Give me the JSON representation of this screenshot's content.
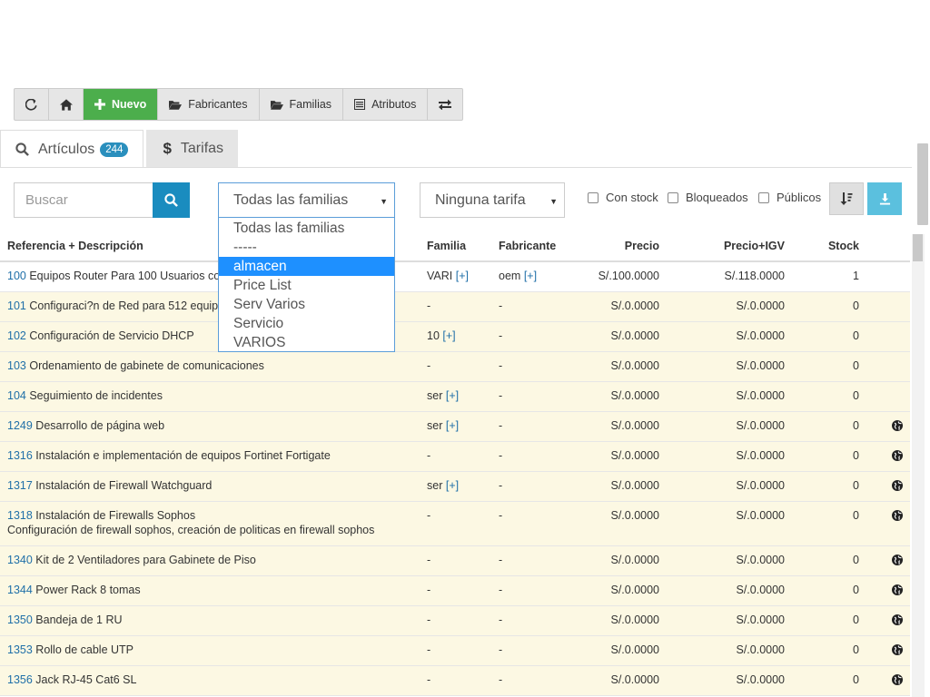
{
  "toolbar": {
    "nuevo_label": "Nuevo",
    "fabricantes_label": "Fabricantes",
    "familias_label": "Familias",
    "atributos_label": "Atributos"
  },
  "tabs": {
    "articulos_label": "Artículos",
    "articulos_count": "244",
    "tarifas_label": "Tarifas"
  },
  "filters": {
    "search_placeholder": "Buscar",
    "familia_selected": "Todas las familias",
    "tarifa_selected": "Ninguna tarifa",
    "con_stock": "Con stock",
    "bloqueados": "Bloqueados",
    "publicos": "Públicos"
  },
  "family_dropdown": {
    "options": [
      "Todas las familias",
      "-----",
      "almacen",
      "Price List",
      "Serv Varios",
      "Servicio",
      "VARIOS"
    ],
    "highlighted": "almacen"
  },
  "table": {
    "headers": {
      "ref_desc": "Referencia + Descripción",
      "familia": "Familia",
      "fabricante": "Fabricante",
      "precio": "Precio",
      "precio_igv": "Precio+IGV",
      "stock": "Stock"
    },
    "rows": [
      {
        "ref": "100",
        "desc": "Equipos Router Para 100 Usuarios co",
        "desc2": "",
        "fam": "VARI",
        "fam_plus": "[+]",
        "fab": "oem",
        "fab_plus": "[+]",
        "precio": "S/.100.0000",
        "igv": "S/.118.0000",
        "stock": "1",
        "public": false
      },
      {
        "ref": "101",
        "desc": "Configuraci?n de Red para 512 equipo",
        "desc2": "",
        "fam": "-",
        "fam_plus": "",
        "fab": "-",
        "fab_plus": "",
        "precio": "S/.0.0000",
        "igv": "S/.0.0000",
        "stock": "0",
        "public": false
      },
      {
        "ref": "102",
        "desc": "Configuración de Servicio DHCP",
        "desc2": "",
        "fam": "10",
        "fam_plus": "[+]",
        "fab": "-",
        "fab_plus": "",
        "precio": "S/.0.0000",
        "igv": "S/.0.0000",
        "stock": "0",
        "public": false
      },
      {
        "ref": "103",
        "desc": "Ordenamiento de gabinete de comunicaciones",
        "desc2": "",
        "fam": "-",
        "fam_plus": "",
        "fab": "-",
        "fab_plus": "",
        "precio": "S/.0.0000",
        "igv": "S/.0.0000",
        "stock": "0",
        "public": false
      },
      {
        "ref": "104",
        "desc": "Seguimiento de incidentes",
        "desc2": "",
        "fam": "ser",
        "fam_plus": "[+]",
        "fab": "-",
        "fab_plus": "",
        "precio": "S/.0.0000",
        "igv": "S/.0.0000",
        "stock": "0",
        "public": false
      },
      {
        "ref": "1249",
        "desc": "Desarrollo de página web",
        "desc2": "",
        "fam": "ser",
        "fam_plus": "[+]",
        "fab": "-",
        "fab_plus": "",
        "precio": "S/.0.0000",
        "igv": "S/.0.0000",
        "stock": "0",
        "public": true
      },
      {
        "ref": "1316",
        "desc": "Instalación e implementación de equipos Fortinet Fortigate",
        "desc2": "",
        "fam": "-",
        "fam_plus": "",
        "fab": "-",
        "fab_plus": "",
        "precio": "S/.0.0000",
        "igv": "S/.0.0000",
        "stock": "0",
        "public": true
      },
      {
        "ref": "1317",
        "desc": "Instalación de Firewall Watchguard",
        "desc2": "",
        "fam": "ser",
        "fam_plus": "[+]",
        "fab": "-",
        "fab_plus": "",
        "precio": "S/.0.0000",
        "igv": "S/.0.0000",
        "stock": "0",
        "public": true
      },
      {
        "ref": "1318",
        "desc": "Instalación de Firewalls Sophos",
        "desc2": "Configuración de firewall sophos, creación de politicas en firewall sophos",
        "fam": "-",
        "fam_plus": "",
        "fab": "-",
        "fab_plus": "",
        "precio": "S/.0.0000",
        "igv": "S/.0.0000",
        "stock": "0",
        "public": true
      },
      {
        "ref": "1340",
        "desc": "Kit de 2 Ventiladores para Gabinete de Piso",
        "desc2": "",
        "fam": "-",
        "fam_plus": "",
        "fab": "-",
        "fab_plus": "",
        "precio": "S/.0.0000",
        "igv": "S/.0.0000",
        "stock": "0",
        "public": true
      },
      {
        "ref": "1344",
        "desc": "Power Rack 8 tomas",
        "desc2": "",
        "fam": "-",
        "fam_plus": "",
        "fab": "-",
        "fab_plus": "",
        "precio": "S/.0.0000",
        "igv": "S/.0.0000",
        "stock": "0",
        "public": true
      },
      {
        "ref": "1350",
        "desc": "Bandeja de 1 RU",
        "desc2": "",
        "fam": "-",
        "fam_plus": "",
        "fab": "-",
        "fab_plus": "",
        "precio": "S/.0.0000",
        "igv": "S/.0.0000",
        "stock": "0",
        "public": true
      },
      {
        "ref": "1353",
        "desc": "Rollo de cable UTP",
        "desc2": "",
        "fam": "-",
        "fam_plus": "",
        "fab": "-",
        "fab_plus": "",
        "precio": "S/.0.0000",
        "igv": "S/.0.0000",
        "stock": "0",
        "public": true
      },
      {
        "ref": "1356",
        "desc": "Jack RJ-45 Cat6 SL",
        "desc2": "",
        "fam": "-",
        "fam_plus": "",
        "fab": "-",
        "fab_plus": "",
        "precio": "S/.0.0000",
        "igv": "S/.0.0000",
        "stock": "0",
        "public": true
      }
    ]
  },
  "colors": {
    "accent_green": "#4cae4c",
    "accent_blue": "#1a8cbf",
    "link_blue": "#1f6fa8",
    "row_highlight": "#fcf8e3",
    "dropdown_selected": "#1e90ff"
  }
}
